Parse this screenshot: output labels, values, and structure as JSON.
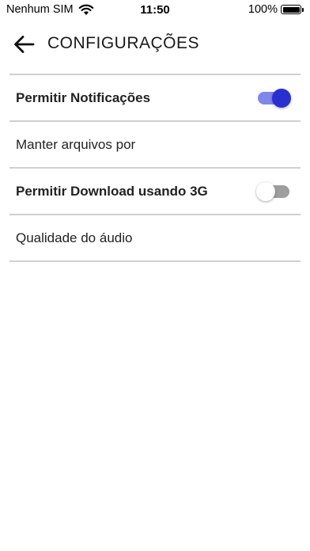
{
  "status_bar": {
    "carrier": "Nenhum SIM",
    "time": "11:50",
    "battery": "100%",
    "wifi_icon": "wifi-icon",
    "battery_icon": "battery-full-icon"
  },
  "header": {
    "title": "CONFIGURAÇÕES",
    "back_icon": "arrow-left-icon"
  },
  "settings": [
    {
      "label": "Permitir Notificações",
      "type": "toggle",
      "value": true
    },
    {
      "label": "Manter arquivos por",
      "type": "option"
    },
    {
      "label": "Permitir Download usando 3G",
      "type": "toggle",
      "value": false
    },
    {
      "label": "Qualidade do áudio",
      "type": "option"
    }
  ],
  "colors": {
    "toggle_on_track": "#8187e8",
    "toggle_on_thumb": "#2a2fd0",
    "toggle_off_track": "#9e9e9e",
    "toggle_off_thumb": "#ffffff",
    "divider": "#d0d0d0"
  }
}
